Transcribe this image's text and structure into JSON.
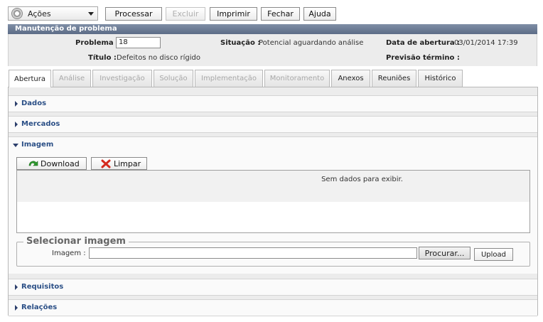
{
  "toolbar": {
    "acoes_label": "Ações",
    "buttons": [
      {
        "label": "Processar",
        "enabled": true
      },
      {
        "label": "Excluir",
        "enabled": false
      },
      {
        "label": "Imprimir",
        "enabled": true
      },
      {
        "label": "Fechar",
        "enabled": true
      },
      {
        "label": "Ajuda",
        "enabled": true
      }
    ]
  },
  "header": {
    "title": "Manutenção de problema",
    "problema_label": "Problema :",
    "problema_value": "18",
    "situacao_label": "Situação :",
    "situacao_value": "Potencial aguardando análise",
    "data_abertura_label": "Data de abertura :",
    "data_abertura_value": "03/01/2014 17:39",
    "titulo_label": "Título :",
    "titulo_value": "Defeitos no disco rígido",
    "previsao_label": "Previsão término :",
    "previsao_value": ""
  },
  "tabs": [
    {
      "label": "Abertura",
      "state": "active"
    },
    {
      "label": "Análise",
      "state": "disabled"
    },
    {
      "label": "Investigação",
      "state": "disabled"
    },
    {
      "label": "Solução",
      "state": "disabled"
    },
    {
      "label": "Implementação",
      "state": "disabled"
    },
    {
      "label": "Monitoramento",
      "state": "disabled"
    },
    {
      "label": "Anexos",
      "state": "enabled"
    },
    {
      "label": "Reuniões",
      "state": "enabled"
    },
    {
      "label": "Histórico",
      "state": "enabled"
    }
  ],
  "sections": {
    "dados": "Dados",
    "mercados": "Mercados",
    "imagem": "Imagem",
    "requisitos": "Requisitos",
    "relacoes": "Relações"
  },
  "imagem": {
    "download_label": "Download",
    "limpar_label": "Limpar",
    "empty_message": "Sem dados para exibir.",
    "selecionar_legend": "Selecionar imagem",
    "imagem_field_label": "Imagem :",
    "browse_label": "Procurar...",
    "upload_label": "Upload"
  }
}
